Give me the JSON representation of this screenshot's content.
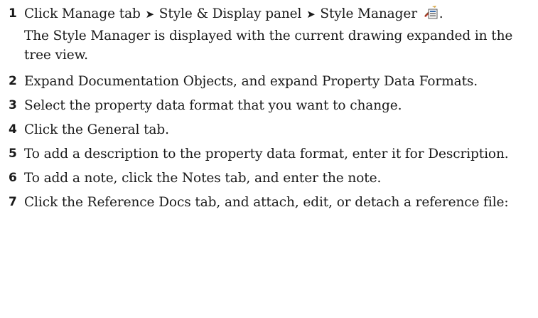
{
  "steps": [
    {
      "number": "1",
      "parts": [
        "Click Manage tab",
        "Style & Display panel",
        "Style Manager"
      ],
      "arrow": "➤",
      "trailing": ".",
      "icon": "style-manager-icon",
      "sub": "The Style Manager is displayed with the current drawing expanded in the tree view."
    },
    {
      "number": "2",
      "text": "Expand Documentation Objects, and expand Property Data Formats."
    },
    {
      "number": "3",
      "text": "Select the property data format that you want to change."
    },
    {
      "number": "4",
      "text": "Click the General tab."
    },
    {
      "number": "5",
      "text": "To add a description to the property data format, enter it for Description."
    },
    {
      "number": "6",
      "text": "To add a note, click the Notes tab, and enter the note."
    },
    {
      "number": "7",
      "text": "Click the Reference Docs tab, and attach, edit, or detach a reference file:"
    }
  ]
}
